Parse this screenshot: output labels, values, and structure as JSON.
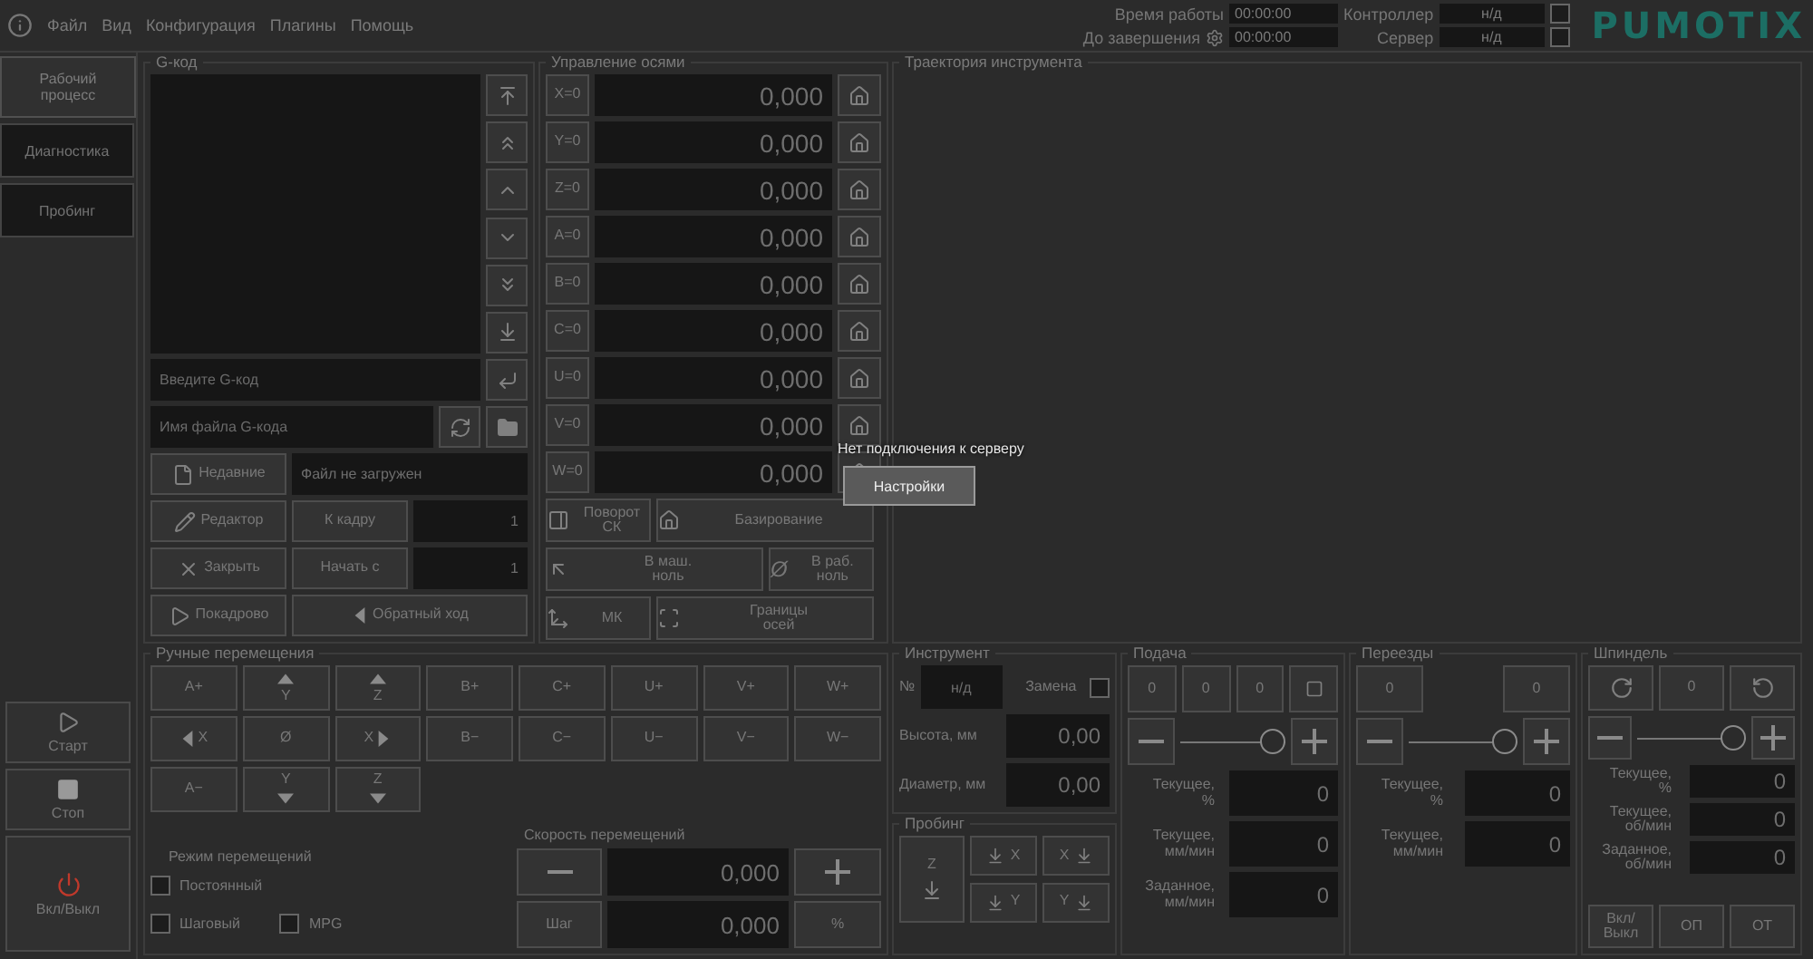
{
  "menu": [
    "Файл",
    "Вид",
    "Конфигурация",
    "Плагины",
    "Помощь"
  ],
  "status": [
    {
      "label": "Время работы",
      "value": "00:00:00",
      "kind": "time"
    },
    {
      "label": "До завершения",
      "value": "00:00:00",
      "kind": "time-gear"
    },
    {
      "label": "Контроллер",
      "value": "н/д",
      "kind": "link",
      "checked": false
    },
    {
      "label": "Сервер",
      "value": "н/д",
      "kind": "link",
      "checked": false
    }
  ],
  "logo": "PUMOTIX",
  "sidebar": {
    "tabs": [
      {
        "label": "Рабочий процесс",
        "selected": true
      },
      {
        "label": "Диагностика",
        "selected": false
      },
      {
        "label": "Пробинг",
        "selected": false
      }
    ],
    "buttons": [
      {
        "label": "Старт",
        "kind": "start"
      },
      {
        "label": "Стоп",
        "kind": "stop"
      },
      {
        "label": "Вкл/Выкл",
        "kind": "power"
      }
    ]
  },
  "gcode": {
    "title": "G-код",
    "input_placeholder": "Введите G-код",
    "file_placeholder": "Имя файла G-кода",
    "recent": "Недавние",
    "file_status": "Файл не загружен",
    "rows": [
      {
        "button": "Редактор",
        "action": "К кадру",
        "value": "1"
      },
      {
        "button": "Закрыть",
        "action": "Начать с",
        "value": "1"
      }
    ],
    "step": "Покадрово",
    "reverse": "Обратный ход"
  },
  "axes": {
    "title": "Управление осями",
    "rows": [
      {
        "zero": "X=0",
        "value": "0,000"
      },
      {
        "zero": "Y=0",
        "value": "0,000"
      },
      {
        "zero": "Z=0",
        "value": "0,000"
      },
      {
        "zero": "A=0",
        "value": "0,000"
      },
      {
        "zero": "B=0",
        "value": "0,000"
      },
      {
        "zero": "C=0",
        "value": "0,000"
      },
      {
        "zero": "U=0",
        "value": "0,000"
      },
      {
        "zero": "V=0",
        "value": "0,000"
      },
      {
        "zero": "W=0",
        "value": "0,000"
      }
    ],
    "buttons": [
      {
        "label": "Поворот\nСК"
      },
      {
        "label": "Базирование"
      },
      {
        "label": "В маш.\nноль"
      },
      {
        "label": "В раб.\nноль",
        "symbol": "Ø"
      },
      {
        "label": "МК"
      },
      {
        "label": "Границы\nосей"
      }
    ]
  },
  "trajectory": {
    "title": "Траектория инструмента"
  },
  "overlay": {
    "message": "Нет подключения к серверу",
    "button": "Настройки"
  },
  "jog": {
    "title": "Ручные перемещения",
    "buttons": [
      {
        "label": "A+",
        "kind": "plain"
      },
      {
        "label": "Y",
        "kind": "up"
      },
      {
        "label": "Z",
        "kind": "up"
      },
      {
        "label": "B+",
        "kind": "plain"
      },
      {
        "label": "C+",
        "kind": "plain"
      },
      {
        "label": "U+",
        "kind": "plain"
      },
      {
        "label": "V+",
        "kind": "plain"
      },
      {
        "label": "W+",
        "kind": "plain"
      },
      {
        "label": "X",
        "kind": "left"
      },
      {
        "label": "Ø",
        "kind": "plain"
      },
      {
        "label": "X",
        "kind": "right"
      },
      {
        "label": "B−",
        "kind": "plain"
      },
      {
        "label": "C−",
        "kind": "plain"
      },
      {
        "label": "U−",
        "kind": "plain"
      },
      {
        "label": "V−",
        "kind": "plain"
      },
      {
        "label": "W−",
        "kind": "plain"
      },
      {
        "label": "A−",
        "kind": "plain"
      },
      {
        "label": "Y",
        "kind": "down"
      },
      {
        "label": "Z",
        "kind": "down"
      }
    ],
    "mode_title": "Режим перемещений",
    "modes": [
      {
        "label": "Постоянный",
        "checked": false
      },
      {
        "label": "Шаговый",
        "checked": false
      },
      {
        "label": "MPG",
        "checked": false
      }
    ],
    "speed_title": "Скорость перемещений",
    "speed": "0,000",
    "step_button": "Шаг",
    "step": "0,000",
    "percent_button": "%"
  },
  "tool": {
    "title": "Инструмент",
    "number_label": "№",
    "number": "н/д",
    "change_label": "Замена",
    "change_checked": false,
    "fields": [
      {
        "label": "Высота, мм",
        "value": "0,00"
      },
      {
        "label": "Диаметр, мм",
        "value": "0,00"
      }
    ]
  },
  "probing": {
    "title": "Пробинг",
    "buttons": [
      {
        "label": "Z",
        "kind": "z"
      },
      {
        "label": "X",
        "kind": "left"
      },
      {
        "label": "X",
        "kind": "right"
      },
      {
        "label": "Y",
        "kind": "left"
      },
      {
        "label": "Y",
        "kind": "right"
      }
    ]
  },
  "feed": {
    "title": "Подача",
    "presets": [
      "0",
      "0",
      "0"
    ],
    "level": 1,
    "readings": [
      {
        "label": "Текущее,\n%",
        "value": "0"
      },
      {
        "label": "Текущее,\nмм/мин",
        "value": "0"
      },
      {
        "label": "Заданное,\nмм/мин",
        "value": "0"
      }
    ]
  },
  "rapids": {
    "title": "Переезды",
    "presets": [
      "0",
      "0"
    ],
    "level": 1,
    "readings": [
      {
        "label": "Текущее,\n%",
        "value": "0"
      },
      {
        "label": "Текущее,\nмм/мин",
        "value": "0"
      }
    ]
  },
  "spindle": {
    "title": "Шпиндель",
    "preset": "0",
    "level": 1,
    "readings": [
      {
        "label": "Текущее,\n%",
        "value": "0"
      },
      {
        "label": "Текущее,\nоб/мин",
        "value": "0"
      },
      {
        "label": "Заданное,\nоб/мин",
        "value": "0"
      }
    ],
    "buttons": [
      "Вкл/\nВыкл",
      "ОП",
      "ОТ"
    ]
  }
}
